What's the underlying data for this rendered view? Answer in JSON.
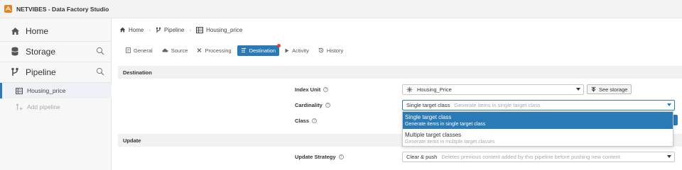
{
  "app": {
    "title": "NETVIBES - Data Factory Studio",
    "logo_icon": "netvibes-logo-icon"
  },
  "colors": {
    "accent": "#2a7ab5",
    "logo": "#e8811e",
    "notification": "#e0442b"
  },
  "sidebar": {
    "items": [
      {
        "label": "Home",
        "icon": "home-icon"
      },
      {
        "label": "Storage",
        "icon": "database-icon",
        "search_icon": "search-icon"
      },
      {
        "label": "Pipeline",
        "icon": "branch-icon",
        "search_icon": "search-icon"
      }
    ],
    "pipeline_children": [
      {
        "label": "Housing_price",
        "icon": "table-icon",
        "active": true
      },
      {
        "label": "Add pipeline",
        "icon": "add-branch-icon",
        "muted": true
      }
    ]
  },
  "breadcrumb": [
    {
      "label": "Home",
      "icon": "home-icon"
    },
    {
      "label": "Pipeline",
      "icon": "branch-icon"
    },
    {
      "label": "Housing_price",
      "icon": "table-icon"
    }
  ],
  "tabs": [
    {
      "label": "General",
      "icon": "document-icon"
    },
    {
      "label": "Source",
      "icon": "cloud-icon"
    },
    {
      "label": "Processing",
      "icon": "function-icon"
    },
    {
      "label": "Destination",
      "icon": "destination-icon",
      "active": true
    },
    {
      "label": "Activity",
      "icon": "play-icon"
    },
    {
      "label": "History",
      "icon": "history-icon"
    }
  ],
  "destination": {
    "section_title": "Destination",
    "index_unit": {
      "label": "Index Unit",
      "value": "Housing_Price",
      "value_icon": "index-unit-icon",
      "button_label": "See storage",
      "button_icon": "storage-icon"
    },
    "cardinality": {
      "label": "Cardinality",
      "value": "Single target class",
      "hint": "Generate items in single target class",
      "options": [
        {
          "title": "Single target class",
          "desc": "Generate items in single target class",
          "selected": true
        },
        {
          "title": "Multiple target classes",
          "desc": "Generate items in multiple target classes",
          "selected": false
        }
      ]
    },
    "class": {
      "label": "Class"
    }
  },
  "update": {
    "section_title": "Update",
    "strategy": {
      "label": "Update Strategy",
      "value": "Clear & push",
      "hint": "Deletes previous content added by this pipeline before pushing new content"
    }
  },
  "help_glyph": "?"
}
